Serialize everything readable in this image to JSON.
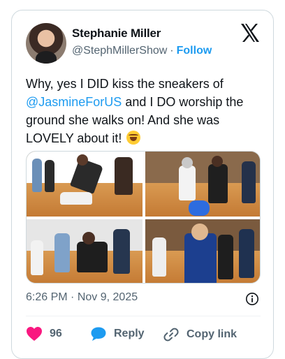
{
  "author": {
    "name": "Stephanie Miller",
    "handle": "@StephMillerShow",
    "separator": "·",
    "follow_label": "Follow"
  },
  "tweet": {
    "text_part1": "Why, yes I DID kiss the sneakers of ",
    "mention": "@JasmineForUS",
    "text_part2": " and I DO worship the ground she walks on! And she was LOVELY about it! "
  },
  "meta": {
    "time": "6:26 PM",
    "separator": "·",
    "date": "Nov 9, 2025"
  },
  "actions": {
    "like_count": "96",
    "reply_label": "Reply",
    "copy_label": "Copy link"
  },
  "icons": {
    "logo": "x-logo-icon",
    "like": "heart-icon",
    "reply": "speech-bubble-icon",
    "copy": "link-icon",
    "info": "info-icon",
    "emoji": "rolling-laughing-emoji"
  },
  "colors": {
    "accent": "#1d9bf0",
    "like": "#f91880",
    "muted": "#536471"
  }
}
